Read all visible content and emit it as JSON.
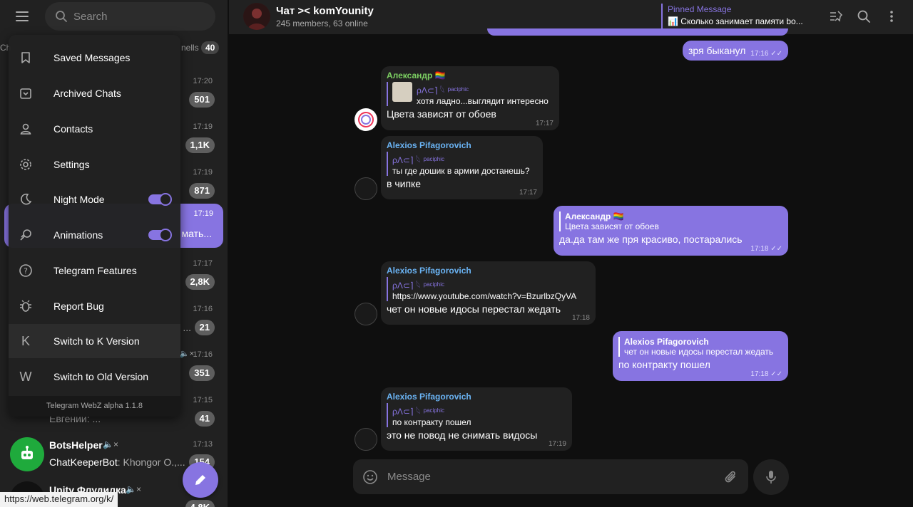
{
  "search": {
    "placeholder": "Search"
  },
  "tabs": {
    "left_fragment": "Ch",
    "right_fragment": "nells",
    "count": "40"
  },
  "chat_list": [
    {
      "time": "17:20",
      "badge": "501"
    },
    {
      "time": "17:19",
      "badge": "1,1K"
    },
    {
      "time": "17:19",
      "badge": "871"
    },
    {
      "time": "17:19",
      "snippet": "мать..."
    },
    {
      "time": "17:17",
      "badge": "2,8K"
    },
    {
      "time": "17:16",
      "badge": "21",
      "dots": "..."
    },
    {
      "time": "17:16",
      "badge": "351"
    },
    {
      "time": "17:15",
      "badge": "41",
      "preview": "Евгений: ..."
    }
  ],
  "bots_helper": {
    "name": "BotsHelper",
    "preview_sender": "ChatKeeperBot",
    "preview_text": ": Khongor O.,...",
    "time": "17:13",
    "badge": "154"
  },
  "unity": {
    "name": "Unity Флудилка",
    "badge": "4,8K"
  },
  "menu": {
    "items": [
      {
        "label": "Saved Messages",
        "icon": "bookmark-icon"
      },
      {
        "label": "Archived Chats",
        "icon": "archive-icon"
      },
      {
        "label": "Contacts",
        "icon": "user-icon"
      },
      {
        "label": "Settings",
        "icon": "gear-icon"
      },
      {
        "label": "Night Mode",
        "icon": "moon-icon",
        "toggle": true
      },
      {
        "label": "Animations",
        "icon": "animations-icon",
        "toggle": true
      },
      {
        "label": "Telegram Features",
        "icon": "question-icon"
      },
      {
        "label": "Report Bug",
        "icon": "bug-icon"
      },
      {
        "label": "Switch to K Version",
        "icon": "k-letter-icon",
        "letter": "K"
      },
      {
        "label": "Switch to Old Version",
        "icon": "w-letter-icon",
        "letter": "W"
      }
    ],
    "footer": "Telegram WebZ alpha 1.1.8"
  },
  "status_url": "https://web.telegram.org/k/",
  "header": {
    "title": "Чат >< komYounity",
    "subtitle": "245 members, 63 online",
    "pinned_label": "Pinned Message",
    "pinned_text": "📊 Сколько занимает памяти bo..."
  },
  "messages": [
    {
      "side": "out",
      "text": "зря быканул",
      "time": "17:16"
    },
    {
      "side": "in",
      "sender": "Александр 🏳️‍🌈",
      "sender_color": "#7ccf62",
      "reply_name": "ρΛ⊂⌉ 𓆩",
      "reply_sub": "paciphic",
      "reply_text": "хотя ладно...выглядит интересно",
      "text": "Цвета зависят от обоев",
      "time": "17:17"
    },
    {
      "side": "in",
      "sender": "Alexios Pifagorovich",
      "sender_color": "#6ab3f3",
      "reply_name": "ρΛ⊂⌉ 𓆩",
      "reply_sub": "paciphic",
      "reply_text": "ты где дошик в армии достанешь?",
      "text": "в чипке",
      "time": "17:17"
    },
    {
      "side": "out",
      "reply_name": "Александр 🏳️‍🌈",
      "reply_text": "Цвета зависят от обоев",
      "text": "да.да там же пря красиво, постарались",
      "time": "17:18"
    },
    {
      "side": "in",
      "sender": "Alexios Pifagorovich",
      "sender_color": "#6ab3f3",
      "reply_name": "ρΛ⊂⌉ 𓆩",
      "reply_sub": "paciphic",
      "reply_text": "https://www.youtube.com/watch?v=BzurlbzQyVA",
      "text": "чет он новые идосы перестал жедать",
      "time": "17:18"
    },
    {
      "side": "out",
      "reply_name": "Alexios Pifagorovich",
      "reply_text": "чет он новые идосы перестал жедать",
      "text": "по контракту пошел",
      "time": "17:18"
    },
    {
      "side": "in",
      "sender": "Alexios Pifagorovich",
      "sender_color": "#6ab3f3",
      "reply_name": "ρΛ⊂⌉ 𓆩",
      "reply_sub": "paciphic",
      "reply_text": "по контракту пошел",
      "text": "это не повод не снимать видосы",
      "time": "17:19"
    }
  ],
  "composer": {
    "placeholder": "Message"
  },
  "colors": {
    "accent": "#8774e1",
    "bg_dark": "#0f0f0f",
    "panel": "#212121"
  }
}
